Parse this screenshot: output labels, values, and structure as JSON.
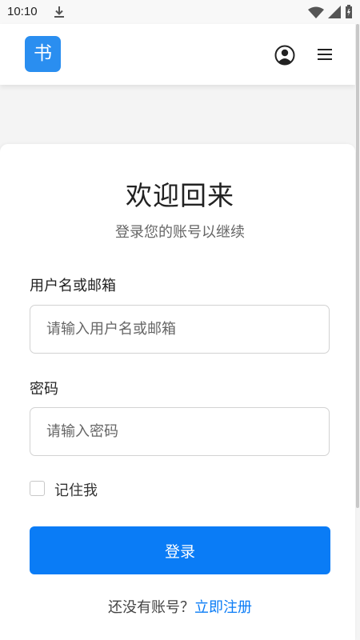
{
  "status_bar": {
    "time": "10:10"
  },
  "header": {
    "logo_text": "书"
  },
  "login": {
    "title": "欢迎回来",
    "subtitle": "登录您的账号以继续",
    "username_label": "用户名或邮箱",
    "username_placeholder": "请输入用户名或邮箱",
    "username_value": "",
    "password_label": "密码",
    "password_placeholder": "请输入密码",
    "password_value": "",
    "remember_label": "记住我",
    "remember_checked": false,
    "submit_label": "登录",
    "register_prompt": "还没有账号？",
    "register_link": "立即注册"
  },
  "colors": {
    "primary": "#0a7cf6",
    "logo_bg": "#2a8ef0"
  }
}
